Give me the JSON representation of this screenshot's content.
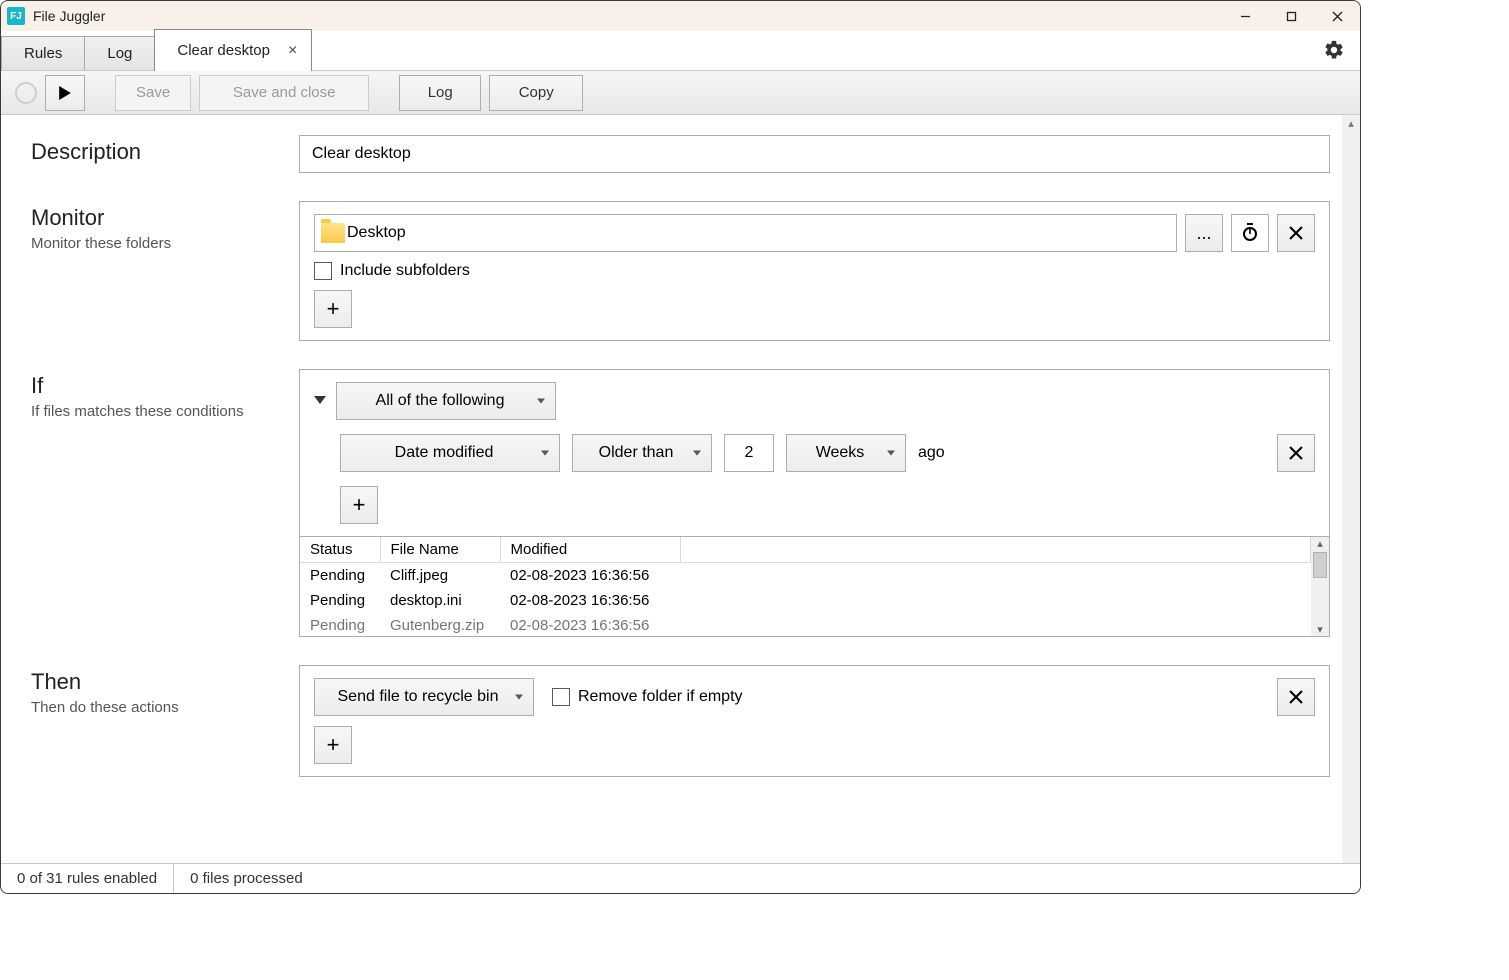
{
  "titlebar": {
    "app_name": "File Juggler"
  },
  "tabs": {
    "rules": "Rules",
    "log": "Log",
    "active": "Clear desktop"
  },
  "toolbar": {
    "save": "Save",
    "save_close": "Save and close",
    "log": "Log",
    "copy": "Copy"
  },
  "description": {
    "label": "Description",
    "value": "Clear desktop"
  },
  "monitor": {
    "label": "Monitor",
    "sub": "Monitor these folders",
    "folder_name": "Desktop",
    "browse": "...",
    "include_subfolders": "Include subfolders"
  },
  "if": {
    "label": "If",
    "sub": "If files matches these conditions",
    "combine": "All of the following",
    "condition": {
      "field": "Date modified",
      "op": "Older than",
      "value": "2",
      "unit": "Weeks",
      "suffix": "ago"
    },
    "table": {
      "headers": {
        "status": "Status",
        "file": "File Name",
        "modified": "Modified"
      },
      "rows": [
        {
          "status": "Pending",
          "file": "Cliff.jpeg",
          "modified": "02-08-2023 16:36:56"
        },
        {
          "status": "Pending",
          "file": "desktop.ini",
          "modified": "02-08-2023 16:36:56"
        },
        {
          "status": "Pending",
          "file": "Gutenberg.zip",
          "modified": "02-08-2023 16:36:56"
        }
      ]
    }
  },
  "then": {
    "label": "Then",
    "sub": "Then do these actions",
    "action": "Send file to recycle bin",
    "remove_empty": "Remove folder if empty"
  },
  "statusbar": {
    "rules": "0 of 31 rules enabled",
    "files": "0 files processed"
  }
}
